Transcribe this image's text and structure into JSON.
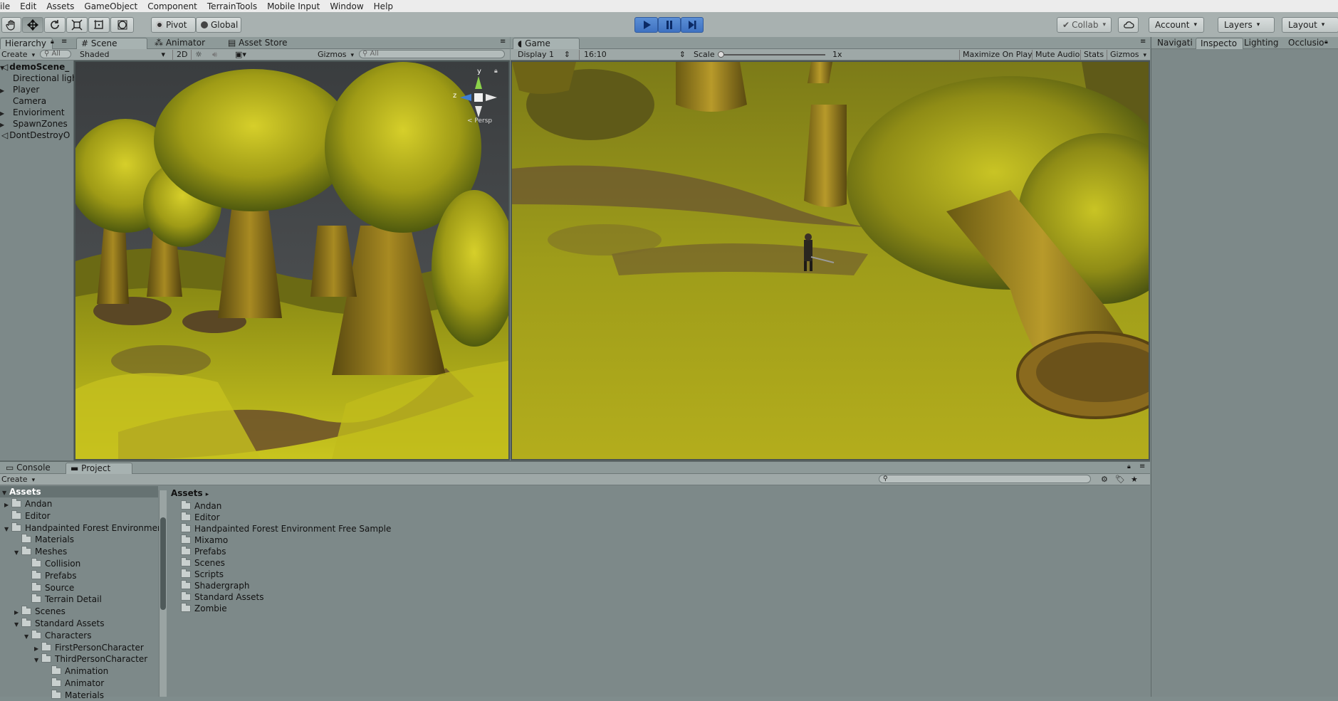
{
  "menu": [
    "File",
    "Edit",
    "Assets",
    "GameObject",
    "Component",
    "TerrainTools",
    "Mobile Input",
    "Window",
    "Help"
  ],
  "toolbar": {
    "tools": [
      "hand-icon",
      "move-icon",
      "rotate-icon",
      "scale-icon",
      "rect-icon",
      "transform-icon"
    ],
    "pivot": "Pivot",
    "global": "Global",
    "collab": "Collab",
    "account": "Account",
    "layers": "Layers",
    "layout": "Layout"
  },
  "hierarchy": {
    "tab": "Hierarchy",
    "create": "Create",
    "search_placeholder": "All",
    "items": [
      {
        "label": "demoScene_",
        "expanded": true,
        "scene": true
      },
      {
        "label": "Directional ligh"
      },
      {
        "label": "Player",
        "collapsed": true
      },
      {
        "label": "Camera"
      },
      {
        "label": "Envioriment",
        "collapsed": true
      },
      {
        "label": "SpawnZones",
        "collapsed": true
      },
      {
        "label": "DontDestroyO",
        "scene": true
      }
    ]
  },
  "scene": {
    "tabs": [
      "Scene",
      "Animator",
      "Asset Store"
    ],
    "shaded": "Shaded",
    "mode2d": "2D",
    "gizmos": "Gizmos",
    "search_placeholder": "All",
    "persp": "< Persp",
    "axis_y": "y",
    "axis_z": "z"
  },
  "game": {
    "tab": "Game",
    "display": "Display 1",
    "aspect": "16:10",
    "scale_label": "Scale",
    "scale_value": "1x",
    "maximize": "Maximize On Play",
    "mute": "Mute Audio",
    "stats": "Stats",
    "gizmos": "Gizmos"
  },
  "inspector_tabs": [
    "Navigati",
    "Inspecto",
    "Lighting",
    "Occlusio"
  ],
  "bottom": {
    "tabs": [
      "Console",
      "Project"
    ],
    "create": "Create",
    "tree_root": "Assets",
    "tree": [
      {
        "label": "Andan",
        "depth": 0,
        "arrow": "right"
      },
      {
        "label": "Editor",
        "depth": 0
      },
      {
        "label": "Handpainted Forest Environment",
        "depth": 0,
        "arrow": "down"
      },
      {
        "label": "Materials",
        "depth": 1
      },
      {
        "label": "Meshes",
        "depth": 1,
        "arrow": "down"
      },
      {
        "label": "Collision",
        "depth": 2
      },
      {
        "label": "Prefabs",
        "depth": 2
      },
      {
        "label": "Source",
        "depth": 2
      },
      {
        "label": "Terrain Detail",
        "depth": 2
      },
      {
        "label": "Scenes",
        "depth": 1,
        "arrow": "right"
      },
      {
        "label": "Standard Assets",
        "depth": 1,
        "arrow": "down"
      },
      {
        "label": "Characters",
        "depth": 2,
        "arrow": "down"
      },
      {
        "label": "FirstPersonCharacter",
        "depth": 3,
        "arrow": "right"
      },
      {
        "label": "ThirdPersonCharacter",
        "depth": 3,
        "arrow": "down"
      },
      {
        "label": "Animation",
        "depth": 4
      },
      {
        "label": "Animator",
        "depth": 4
      },
      {
        "label": "Materials",
        "depth": 4
      }
    ],
    "breadcrumb": "Assets",
    "folders": [
      "Andan",
      "Editor",
      "Handpainted Forest Environment Free Sample",
      "Mixamo",
      "Prefabs",
      "Scenes",
      "Scripts",
      "Shadergraph",
      "Standard Assets",
      "Zombie"
    ]
  }
}
